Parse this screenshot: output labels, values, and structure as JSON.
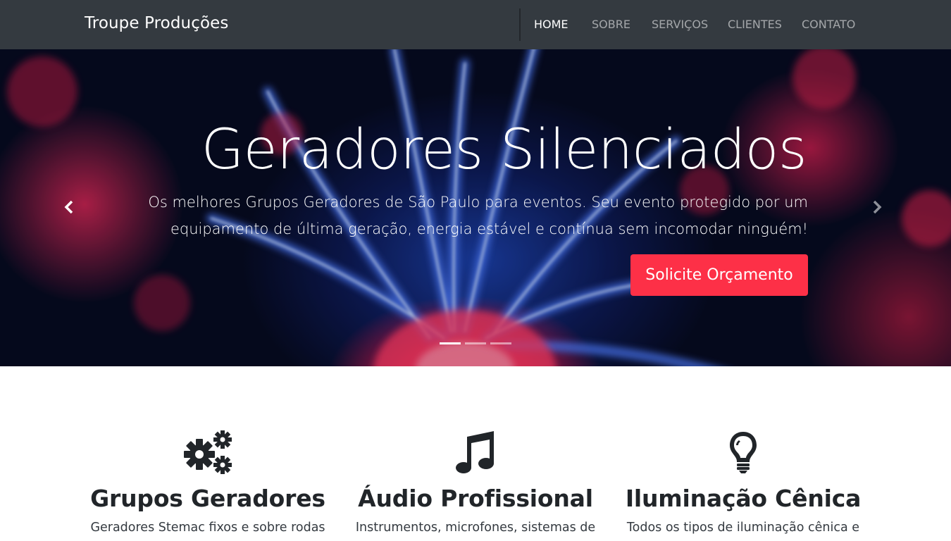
{
  "navbar": {
    "brand": "Troupe Produções",
    "items": [
      {
        "label": "HOME",
        "active": true
      },
      {
        "label": "SOBRE",
        "active": false
      },
      {
        "label": "SERVIÇOS",
        "active": false
      },
      {
        "label": "CLIENTES",
        "active": false
      },
      {
        "label": "CONTATO",
        "active": false
      }
    ]
  },
  "hero": {
    "title": "Geradores Silenciados",
    "text_line1": "Os melhores Grupos Geradores de São Paulo para eventos. Seu evento protegido por um",
    "text_line2": "equipamento de última geração, energia estável e contínua sem incomodar ninguém!",
    "button_label": "Solicite Orçamento",
    "button_color": "#fd3047",
    "prev_icon": "chevron-left-icon",
    "next_icon": "chevron-right-icon",
    "slides_count": 3,
    "active_slide": 1
  },
  "features": [
    {
      "icon": "gears-icon",
      "title": "Grupos Geradores",
      "text": "Geradores Stemac fixos e sobre rodas"
    },
    {
      "icon": "music-note-icon",
      "title": "Áudio Profissional",
      "text": "Instrumentos, microfones, sistemas de"
    },
    {
      "icon": "lightbulb-icon",
      "title": "Iluminação Cênica",
      "text": "Todos os tipos de iluminação cênica e"
    }
  ],
  "colors": {
    "navbar_bg": "#343a40",
    "accent": "#fd3047"
  }
}
